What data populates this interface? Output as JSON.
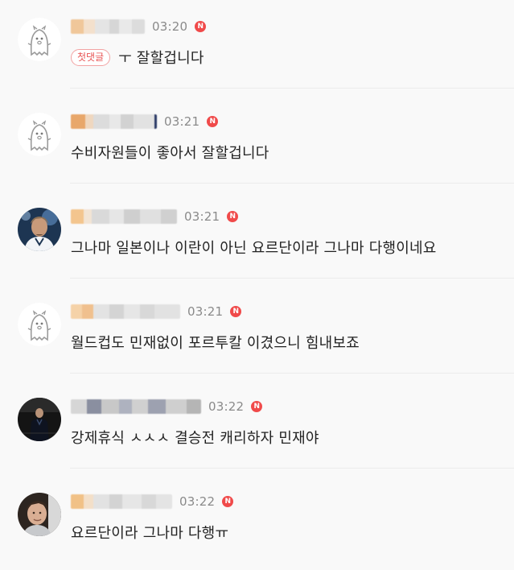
{
  "comments": [
    {
      "time": "03:20",
      "badge_label": "N",
      "first_label": "첫댓글",
      "text": "ㅜ 잘할겁니다",
      "avatar": "ghost-default"
    },
    {
      "time": "03:21",
      "badge_label": "N",
      "text": "수비자원들이 좋아서 잘할겁니다",
      "avatar": "ghost-default"
    },
    {
      "time": "03:21",
      "badge_label": "N",
      "text": "그나마 일본이나 이란이 아닌 요르단이라 그나마 다행이네요",
      "avatar": "player-photo"
    },
    {
      "time": "03:21",
      "badge_label": "N",
      "text": "월드컵도 민재없이 포르투칼 이겼으니 힘내보죠",
      "avatar": "ghost-default"
    },
    {
      "time": "03:22",
      "badge_label": "N",
      "text": "강제휴식 ㅅㅅㅅ 결승전 캐리하자 민재야",
      "avatar": "coach-photo"
    },
    {
      "time": "03:22",
      "badge_label": "N",
      "text": "요르단이라 그나마 다행ㅠ",
      "avatar": "face-photo"
    }
  ],
  "colors": {
    "badge": "#f04a4a",
    "first_border": "#f2a3a3"
  }
}
